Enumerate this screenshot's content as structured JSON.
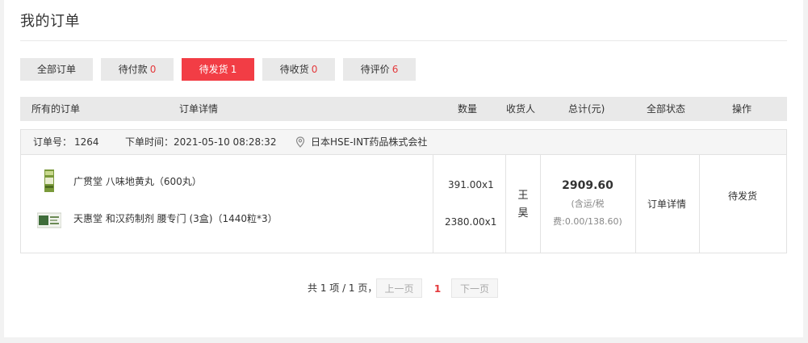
{
  "page": {
    "title": "我的订单"
  },
  "tabs": [
    {
      "label": "全部订单",
      "count": ""
    },
    {
      "label": "待付款",
      "count": "0"
    },
    {
      "label": "待发货",
      "count": "1"
    },
    {
      "label": "待收货",
      "count": "0"
    },
    {
      "label": "待评价",
      "count": "6"
    }
  ],
  "active_tab": "待发货",
  "table_header": {
    "all_orders": "所有的订单",
    "details": "订单详情",
    "quantity": "数量",
    "receiver": "收货人",
    "total": "总计(元)",
    "status": "全部状态",
    "action": "操作"
  },
  "order": {
    "number_label": "订单号：",
    "number": "1264",
    "time_label": "下单时间：",
    "time": "2021-05-10 08:28:32",
    "shop": "日本HSE-INT药品株式会社",
    "items": [
      {
        "name": "广贯堂 八味地黄丸（600丸）",
        "qty": "391.00x1"
      },
      {
        "name": "天惠堂 和汉药制剂 腰专门 (3盒)（1440粒*3）",
        "qty": "2380.00x1"
      }
    ],
    "receiver_line1": "王",
    "receiver_line2": "昊",
    "total": "2909.60",
    "fee_line1": "(含运/税",
    "fee_line2": "费:0.00/138.60)",
    "detail_link": "订单详情",
    "status": "待发货"
  },
  "pagination": {
    "info": "共 1 项 / 1 页，",
    "prev": "上一页",
    "current": "1",
    "next": "下一页"
  },
  "colors": {
    "accent": "#f23d45",
    "count_red": "#e4393c"
  }
}
